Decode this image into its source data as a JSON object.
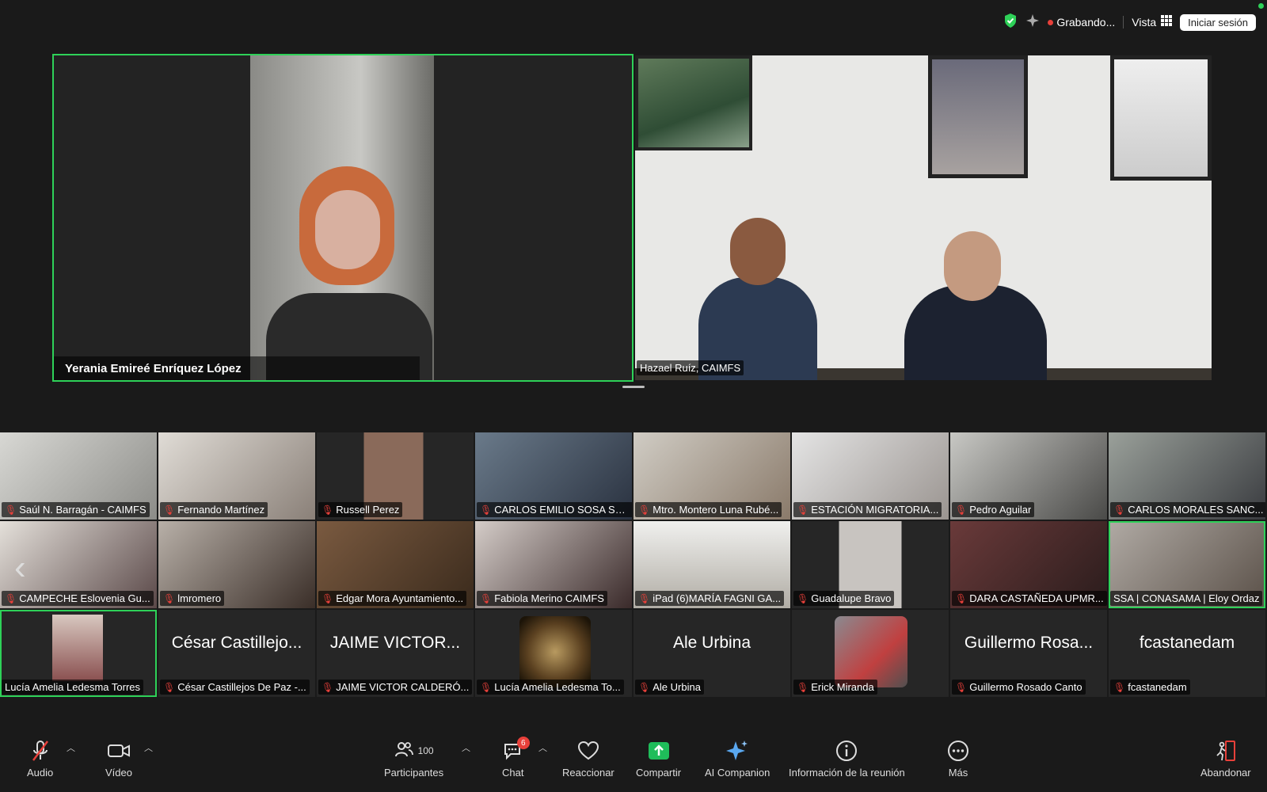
{
  "top_bar": {
    "recording_label": "Grabando...",
    "view_label": "Vista",
    "sign_in_label": "Iniciar sesión"
  },
  "speakers": [
    {
      "name": "Yerania Emireé Enríquez López"
    },
    {
      "name": "Hazael Ruíz, CAIMFS"
    }
  ],
  "gallery": {
    "row1": [
      "Saúl N. Barragán - CAIMFS",
      "Fernando Martínez",
      "Russell Perez",
      "CARLOS EMILIO SOSA SA...",
      "Mtro. Montero Luna Rubé...",
      "ESTACIÓN MIGRATORIA...",
      "Pedro Aguilar",
      "CARLOS MORALES SANC..."
    ],
    "row2": [
      "CAMPECHE Eslovenia Gu...",
      "lmromero",
      "Edgar Mora Ayuntamiento...",
      "Fabiola Merino CAIMFS",
      "iPad (6)MARÍA FAGNI GA...",
      "Guadalupe Bravo",
      "DARA CASTAÑEDA UPMR...",
      "SSA | CONASAMA | Eloy Ordaz"
    ],
    "row3": [
      {
        "label": "Lucía Amelia Ledesma Torres",
        "big": ""
      },
      {
        "label": "César Castillejos De Paz -...",
        "big": "César Castillejo..."
      },
      {
        "label": "JAIME VICTOR CALDERÓ...",
        "big": "JAIME VICTOR..."
      },
      {
        "label": "Lucía Amelia Ledesma To...",
        "big": ""
      },
      {
        "label": "Ale Urbina",
        "big": "Ale Urbina"
      },
      {
        "label": "Erick Miranda",
        "big": ""
      },
      {
        "label": "Guillermo Rosado Canto",
        "big": "Guillermo Rosa..."
      },
      {
        "label": "fcastanedam",
        "big": "fcastanedam"
      }
    ]
  },
  "toolbar": {
    "audio": "Audio",
    "video": "Vídeo",
    "participants": "Participantes",
    "participants_count": "100",
    "chat": "Chat",
    "chat_badge": "6",
    "react": "Reaccionar",
    "share": "Compartir",
    "ai_companion": "AI Companion",
    "meeting_info": "Información de la reunión",
    "more": "Más",
    "leave": "Abandonar"
  },
  "colors": {
    "background": "#1a1a1a",
    "active_speaker_border": "#2ed158",
    "mute_red": "#e8403a",
    "share_green": "#1fbd5a"
  }
}
